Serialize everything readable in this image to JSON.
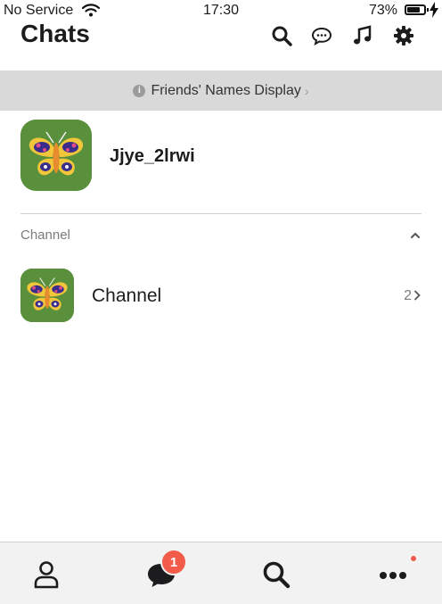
{
  "status_bar": {
    "carrier": "No Service",
    "time": "17:30",
    "battery": "73%",
    "battery_level": 0.73
  },
  "header": {
    "title": "Chats",
    "icons": [
      "search-icon",
      "chat-bubble-icon",
      "music-note-icon",
      "gear-icon"
    ]
  },
  "banner": {
    "text": "Friends' Names Display",
    "chevron": "›"
  },
  "profile": {
    "name": "Jjye_2lrwi",
    "avatar_icon": "butterfly-icon"
  },
  "section": {
    "label": "Channel",
    "caret": "collapse-caret-icon"
  },
  "channel_row": {
    "name": "Channel",
    "count": "2",
    "avatar_icon": "butterfly-icon"
  },
  "tabbar": {
    "tabs": [
      "friends-tab",
      "chats-tab",
      "search-tab",
      "more-tab"
    ],
    "chats_badge": "1"
  },
  "colors": {
    "badge": "#f25a4a",
    "avatar_bg": "#5a8f3c",
    "banner_bg": "#d9d9d9"
  }
}
